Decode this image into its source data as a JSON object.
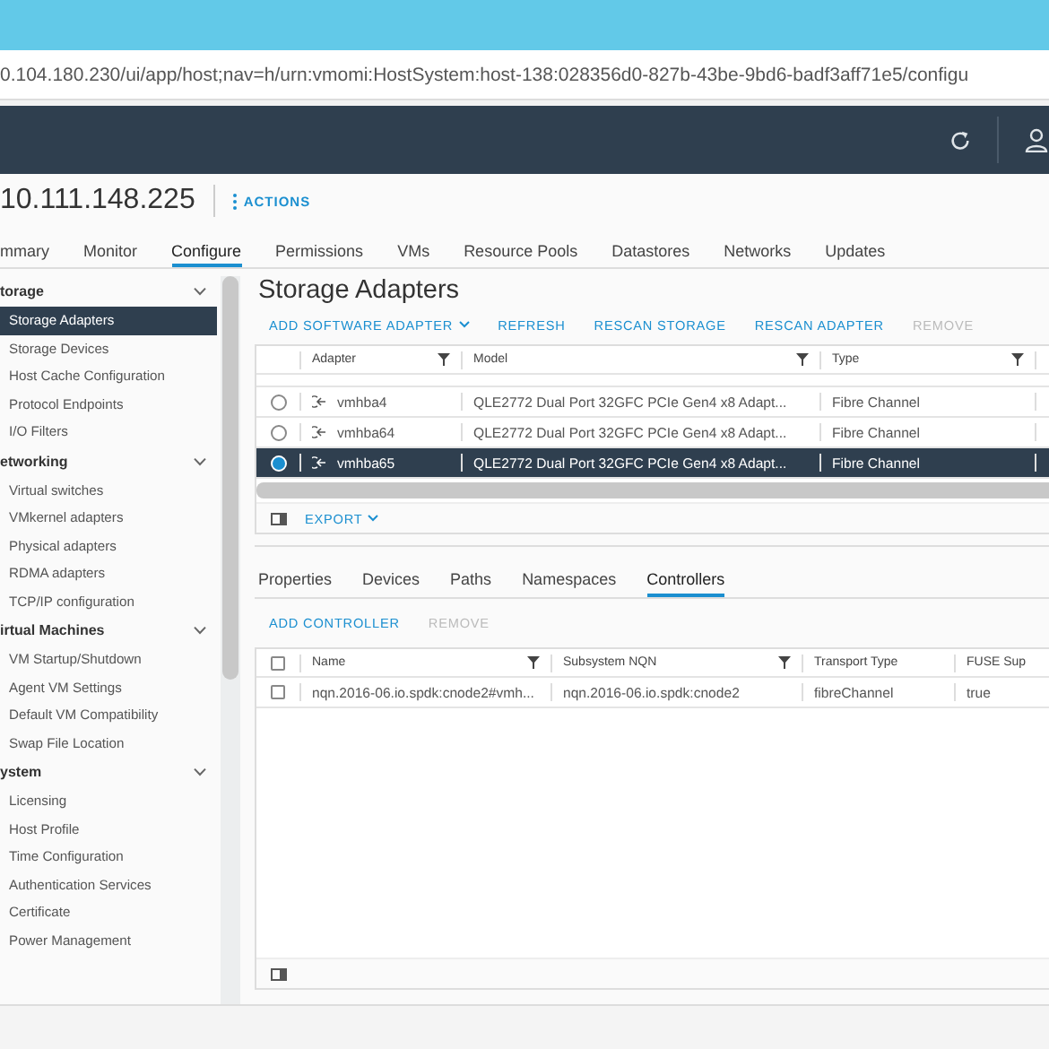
{
  "browser": {
    "url": "0.104.180.230/ui/app/host;nav=h/urn:vmomi:HostSystem:host-138:028356d0-827b-43be-9bd6-badf3aff71e5/configu"
  },
  "host": {
    "name": "10.111.148.225",
    "actions": "ACTIONS"
  },
  "tabs": [
    {
      "label": "mmary",
      "selected": false
    },
    {
      "label": "Monitor",
      "selected": false
    },
    {
      "label": "Configure",
      "selected": true
    },
    {
      "label": "Permissions",
      "selected": false
    },
    {
      "label": "VMs",
      "selected": false
    },
    {
      "label": "Resource Pools",
      "selected": false
    },
    {
      "label": "Datastores",
      "selected": false
    },
    {
      "label": "Networks",
      "selected": false
    },
    {
      "label": "Updates",
      "selected": false
    }
  ],
  "sidebar": {
    "groups": [
      {
        "title": "torage",
        "expanded": true,
        "items": [
          {
            "label": "Storage Adapters",
            "selected": true
          },
          {
            "label": "Storage Devices",
            "selected": false
          },
          {
            "label": "Host Cache Configuration",
            "selected": false
          },
          {
            "label": "Protocol Endpoints",
            "selected": false
          },
          {
            "label": "I/O Filters",
            "selected": false
          }
        ]
      },
      {
        "title": "etworking",
        "expanded": true,
        "items": [
          {
            "label": "Virtual switches",
            "selected": false
          },
          {
            "label": "VMkernel adapters",
            "selected": false
          },
          {
            "label": "Physical adapters",
            "selected": false
          },
          {
            "label": "RDMA adapters",
            "selected": false
          },
          {
            "label": "TCP/IP configuration",
            "selected": false
          }
        ]
      },
      {
        "title": "irtual Machines",
        "expanded": true,
        "items": [
          {
            "label": "VM Startup/Shutdown",
            "selected": false
          },
          {
            "label": "Agent VM Settings",
            "selected": false
          },
          {
            "label": "Default VM Compatibility",
            "selected": false
          },
          {
            "label": "Swap File Location",
            "selected": false
          }
        ]
      },
      {
        "title": "ystem",
        "expanded": true,
        "items": [
          {
            "label": "Licensing",
            "selected": false
          },
          {
            "label": "Host Profile",
            "selected": false
          },
          {
            "label": "Time Configuration",
            "selected": false
          },
          {
            "label": "Authentication Services",
            "selected": false
          },
          {
            "label": "Certificate",
            "selected": false
          },
          {
            "label": "Power Management",
            "selected": false
          }
        ]
      }
    ]
  },
  "adapters": {
    "title": "Storage Adapters",
    "toolbar": [
      {
        "label": "ADD SOFTWARE ADAPTER",
        "disabled": false,
        "dropdown": true
      },
      {
        "label": "REFRESH",
        "disabled": false,
        "dropdown": false
      },
      {
        "label": "RESCAN STORAGE",
        "disabled": false,
        "dropdown": false
      },
      {
        "label": "RESCAN ADAPTER",
        "disabled": false,
        "dropdown": false
      },
      {
        "label": "REMOVE",
        "disabled": true,
        "dropdown": false
      }
    ],
    "columns": [
      "Adapter",
      "Model",
      "Type"
    ],
    "rows": [
      {
        "selected": false,
        "adapter": "vmhba4",
        "model": "QLE2772 Dual Port 32GFC PCIe Gen4 x8 Adapt...",
        "type": "Fibre Channel"
      },
      {
        "selected": false,
        "adapter": "vmhba64",
        "model": "QLE2772 Dual Port 32GFC PCIe Gen4 x8 Adapt...",
        "type": "Fibre Channel"
      },
      {
        "selected": true,
        "adapter": "vmhba65",
        "model": "QLE2772 Dual Port 32GFC PCIe Gen4 x8 Adapt...",
        "type": "Fibre Channel"
      }
    ],
    "export": "EXPORT"
  },
  "detail": {
    "tabs": [
      {
        "label": "Properties",
        "selected": false
      },
      {
        "label": "Devices",
        "selected": false
      },
      {
        "label": "Paths",
        "selected": false
      },
      {
        "label": "Namespaces",
        "selected": false
      },
      {
        "label": "Controllers",
        "selected": true
      }
    ],
    "toolbar": [
      {
        "label": "ADD CONTROLLER",
        "disabled": false
      },
      {
        "label": "REMOVE",
        "disabled": true
      }
    ],
    "select_all_checked": false,
    "columns": [
      "Name",
      "Subsystem NQN",
      "Transport Type",
      "FUSE Sup"
    ],
    "rows": [
      {
        "checked": false,
        "cells": [
          "nqn.2016-06.io.spdk:cnode2#vmh...",
          "nqn.2016-06.io.spdk:cnode2",
          "fibreChannel",
          "true"
        ]
      }
    ]
  }
}
